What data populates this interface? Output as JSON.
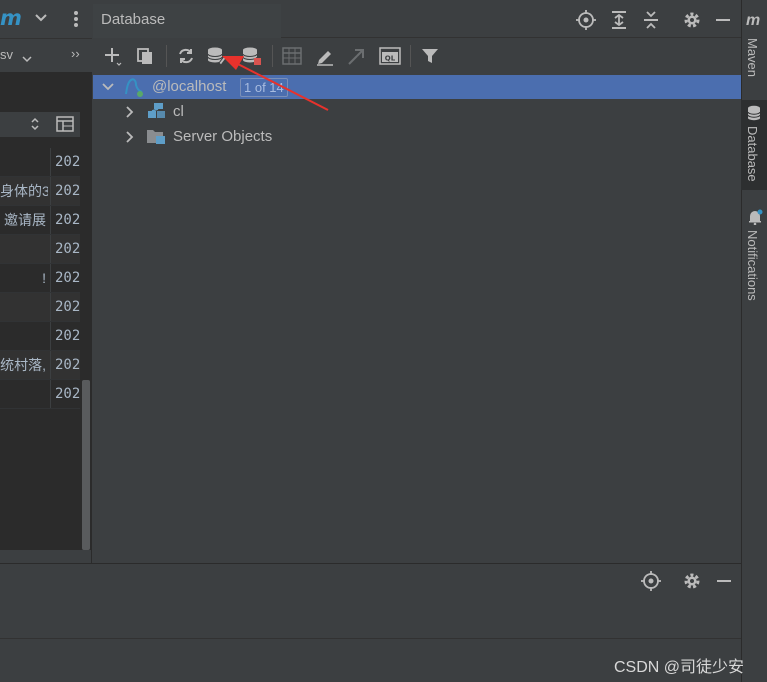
{
  "left": {
    "logo": "m",
    "sub_text": "sv",
    "rows": [
      {
        "a": "",
        "b": "202"
      },
      {
        "a": "身体的3",
        "b": "202"
      },
      {
        "a": "邀请展",
        "b": "202"
      },
      {
        "a": "",
        "b": "202"
      },
      {
        "a": "!",
        "b": "202"
      },
      {
        "a": "",
        "b": "202"
      },
      {
        "a": "",
        "b": "202"
      },
      {
        "a": "统村落,",
        "b": "202"
      },
      {
        "a": "",
        "b": "202"
      }
    ]
  },
  "database": {
    "title": "Database",
    "tree": {
      "root_label": "@localhost",
      "root_badge": "1 of 14",
      "children": [
        "cl",
        "Server Objects"
      ]
    }
  },
  "right_strip": {
    "maven": "Maven",
    "database": "Database",
    "notifications": "Notifications"
  },
  "watermark": "CSDN @司徒少安",
  "colors": {
    "background": "#3c3f41",
    "selection": "#4b6eaf",
    "accent_blue": "#3592c4",
    "annotation_arrow": "#e8322c"
  }
}
